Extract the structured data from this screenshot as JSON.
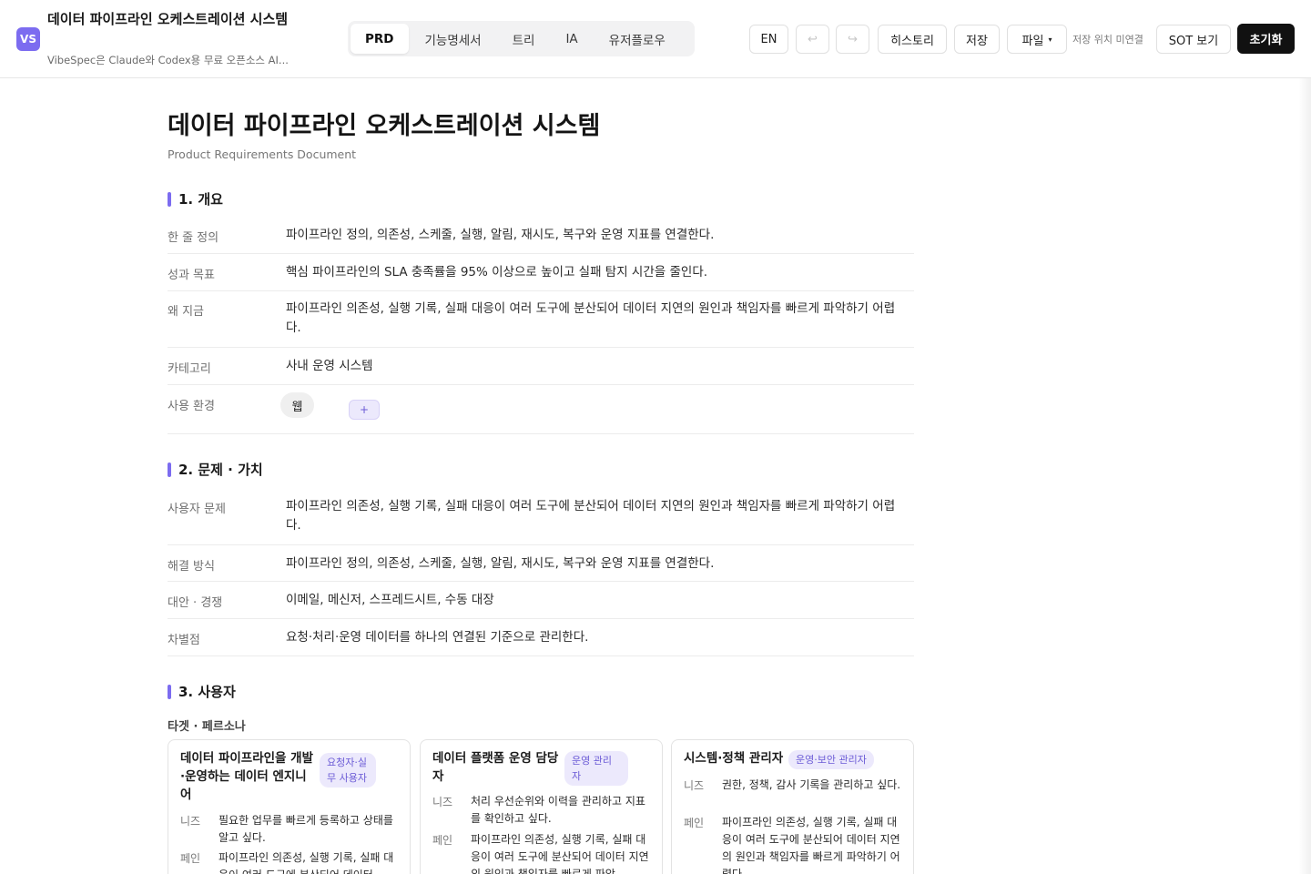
{
  "header": {
    "logo": "VS",
    "title": "데이터 파이프라인 오케스트레이션 시스템",
    "subtitle": "VibeSpec은 Claude와 Codex용 무료 오픈소스 AI...",
    "tabs": [
      "PRD",
      "기능명세서",
      "트리",
      "IA",
      "유저플로우"
    ],
    "active_tab": "PRD",
    "lang_button": "EN",
    "undo_icon": "↩",
    "redo_icon": "↪",
    "history_button": "히스토리",
    "save_button": "저장",
    "file_button": "파일",
    "file_caret": "▾",
    "save_status": "저장 위치 미연결",
    "sot_button": "SOT 보기",
    "reset_button": "초기화"
  },
  "doc": {
    "title": "데이터 파이프라인 오케스트레이션 시스템",
    "subtitle": "Product Requirements Document",
    "sections": {
      "overview": {
        "heading": "1. 개요",
        "rows": [
          {
            "label": "한 줄 정의",
            "value": "파이프라인 정의, 의존성, 스케줄, 실행, 알림, 재시도, 복구와 운영 지표를 연결한다."
          },
          {
            "label": "성과 목표",
            "value": "핵심 파이프라인의 SLA 충족률을 95% 이상으로 높이고 실패 탐지 시간을 줄인다."
          },
          {
            "label": "왜 지금",
            "value": "파이프라인 의존성, 실행 기록, 실패 대응이 여러 도구에 분산되어 데이터 지연의 원인과 책임자를 빠르게 파악하기 어렵다."
          },
          {
            "label": "카테고리",
            "value": "사내 운영 시스템"
          },
          {
            "label": "사용 환경",
            "value": ""
          }
        ],
        "env_chip": "웹",
        "env_add": "+"
      },
      "problem": {
        "heading": "2. 문제 · 가치",
        "rows": [
          {
            "label": "사용자 문제",
            "value": "파이프라인 의존성, 실행 기록, 실패 대응이 여러 도구에 분산되어 데이터 지연의 원인과 책임자를 빠르게 파악하기 어렵다."
          },
          {
            "label": "해결 방식",
            "value": "파이프라인 정의, 의존성, 스케줄, 실행, 알림, 재시도, 복구와 운영 지표를 연결한다."
          },
          {
            "label": "대안 · 경쟁",
            "value": "이메일, 메신저, 스프레드시트, 수동 대장"
          },
          {
            "label": "차별점",
            "value": "요청·처리·운영 데이터를 하나의 연결된 기준으로 관리한다."
          }
        ]
      },
      "users": {
        "heading": "3. 사용자",
        "subheading": "타겟 · 페르소나",
        "personas": [
          {
            "name": "데이터 파이프라인을 개발·운영하는 데이터 엔지니어",
            "badge": "요청자·실무 사용자",
            "needs_label": "니즈",
            "needs": "필요한 업무를 빠르게 등록하고 상태를 알고 싶다.",
            "pain_label": "페인",
            "pain": "파이프라인 의존성, 실행 기록, 실패 대응이 여러 도구에 분산되어 데이터"
          },
          {
            "name": "데이터 플랫폼 운영 담당자",
            "badge": "운영 관리자",
            "needs_label": "니즈",
            "needs": "처리 우선순위와 이력을 관리하고 지표를 확인하고 싶다.",
            "pain_label": "페인",
            "pain": "파이프라인 의존성, 실행 기록, 실패 대응이 여러 도구에 분산되어 데이터 지연의 원인과 책임자를 빠르게 파악"
          },
          {
            "name": "시스템·정책 관리자",
            "badge": "운영·보안 관리자",
            "needs_label": "니즈",
            "needs": "권한, 정책, 감사 기록을 관리하고 싶다.",
            "pain_label": "페인",
            "pain": "파이프라인 의존성, 실행 기록, 실패 대응이 여러 도구에 분산되어 데이터 지연의 원인과 책임자를 빠르게 파악하기 어렵다."
          }
        ]
      }
    }
  }
}
